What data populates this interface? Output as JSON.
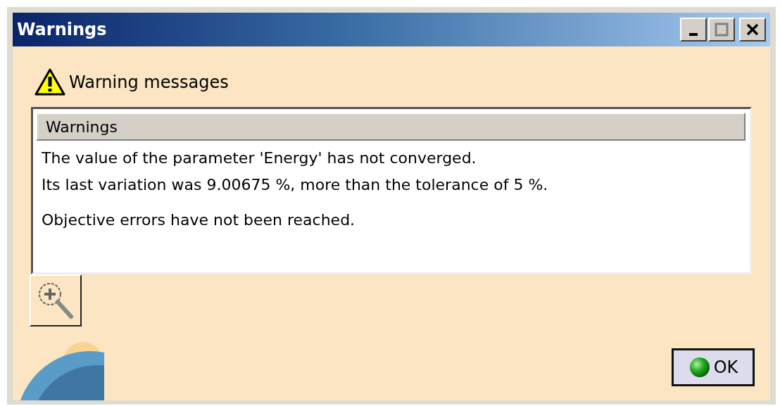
{
  "window": {
    "title": "Warnings",
    "controls": [
      {
        "kind": "minimize"
      },
      {
        "kind": "maximize"
      },
      {
        "kind": "close"
      }
    ]
  },
  "heading": "Warning messages",
  "list": {
    "column": "Warnings",
    "messages": [
      {
        "lines": [
          "The value of the parameter 'Energy' has not converged.",
          "Its last variation was 9.00675 %, more than the tolerance of 5 %."
        ]
      },
      {
        "lines": [
          "Objective errors have not been reached."
        ]
      }
    ]
  },
  "ok_button": "OK"
}
